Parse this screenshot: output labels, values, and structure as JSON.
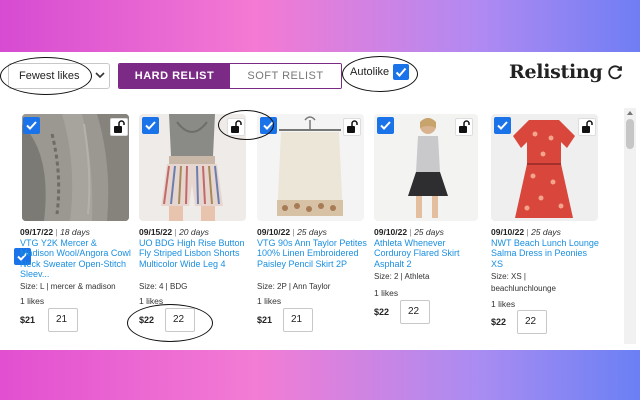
{
  "toolbar": {
    "sort_value": "Fewest likes",
    "hard_relist_label": "HARD RELIST",
    "soft_relist_label": "SOFT RELIST",
    "autolike_label": "Autolike",
    "autolike_checked": true,
    "brand": "Relisting",
    "accent_color": "#7b2a86",
    "checkbox_color": "#1a73e8",
    "link_color": "#1a8fe0"
  },
  "listings": [
    {
      "date": "09/17/22",
      "age": "18 days",
      "title": "VTG Y2K Mercer & Madison Wool/Angora Cowl Neck Sweater Open-Stitch Sleev...",
      "details": "Size: L | mercer & madison",
      "likes": "1 likes",
      "price": "$21",
      "input_value": "21",
      "photo": "grey knit sweater"
    },
    {
      "date": "09/15/22",
      "age": "20 days",
      "title": "UO BDG High Rise Button Fly Striped Lisbon Shorts Multicolor Wide Leg 4",
      "details": "Size: 4 | BDG",
      "likes": "1 likes",
      "price": "$22",
      "input_value": "22",
      "photo": "striped shorts with grey tube top"
    },
    {
      "date": "09/10/22",
      "age": "25 days",
      "title": "VTG 90s Ann Taylor Petites 100% Linen Embroidered Paisley Pencil Skirt 2P",
      "details": "Size: 2P | Ann Taylor",
      "likes": "1 likes",
      "price": "$21",
      "input_value": "21",
      "photo": "cream linen skirt on hanger"
    },
    {
      "date": "09/10/22",
      "age": "25 days",
      "title": "Athleta Whenever Corduroy Flared Skirt Asphalt 2",
      "details": "Size: 2 | Athleta",
      "likes": "1 likes",
      "price": "$22",
      "input_value": "22",
      "photo": "woman in dark skirt"
    },
    {
      "date": "09/10/22",
      "age": "25 days",
      "title": "NWT Beach Lunch Lounge Salma Dress in Peonies XS",
      "details_line1": "Size: XS |",
      "details_line2": "beachlunchlounge",
      "likes": "1 likes",
      "price": "$22",
      "input_value": "22",
      "photo": "red floral dress"
    }
  ]
}
